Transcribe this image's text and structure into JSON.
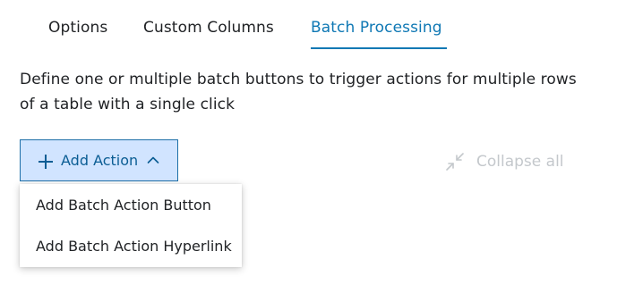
{
  "tabs": [
    {
      "label": "Options",
      "active": false
    },
    {
      "label": "Custom Columns",
      "active": false
    },
    {
      "label": "Batch Processing",
      "active": true
    }
  ],
  "description": "Define one or multiple batch buttons to trigger actions for multiple rows of a table with a single click",
  "add_action": {
    "label": "Add Action",
    "icon": "plus-icon",
    "chevron": "chevron-up-icon",
    "expanded": true
  },
  "collapse_all": {
    "label": "Collapse all",
    "icon": "collapse-arrows-icon",
    "disabled": true
  },
  "menu": {
    "items": [
      {
        "label": "Add Batch Action Button"
      },
      {
        "label": "Add Batch Action Hyperlink"
      }
    ]
  },
  "colors": {
    "accent": "#0f78b4",
    "button_bg": "#d1e4ff",
    "button_text": "#0b5d94",
    "disabled_text": "#c4c8cc"
  }
}
